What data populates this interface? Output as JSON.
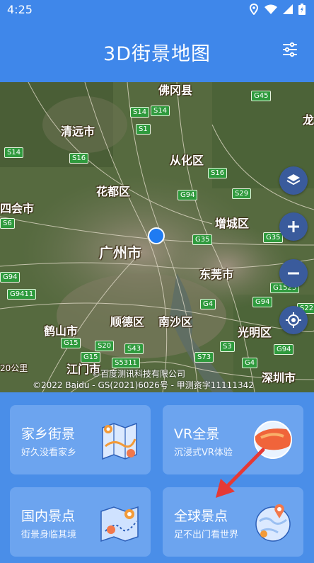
{
  "status_bar": {
    "time": "4:25"
  },
  "app_bar": {
    "title": "3D街景地图"
  },
  "map": {
    "places": {
      "foshan_north": "佛冈县",
      "qingyuan": "清远市",
      "conghua": "从化区",
      "huadu": "花都区",
      "sihui": "四会市",
      "zengcheng": "增城区",
      "guangzhou": "广州市",
      "dongguan": "东莞市",
      "heshan": "鹤山市",
      "shunde": "顺德区",
      "nansha": "南沙区",
      "guangming": "光明区",
      "jiangmen": "江门市",
      "shenzhen": "深圳市",
      "dragon": "龙"
    },
    "roads": [
      "G45",
      "S14",
      "S14",
      "S1",
      "S14",
      "S16",
      "S16",
      "G94",
      "S29",
      "G35",
      "G35",
      "G94",
      "G9411",
      "G4",
      "G94",
      "G15",
      "S20",
      "G15",
      "S43",
      "S5311",
      "S73",
      "S3",
      "G94",
      "G4",
      "S22",
      "G1523",
      "S6"
    ],
    "copyright_line1": "©百度测讯科技有限公司",
    "copyright_line2": "©2022 Baidu - GS(2021)6026号 - 甲测资字11111342",
    "scale_label": "20公里"
  },
  "cards": [
    {
      "title": "家乡街景",
      "subtitle": "好久没看家乡"
    },
    {
      "title": "VR全景",
      "subtitle": "沉浸式VR体验"
    },
    {
      "title": "国内景点",
      "subtitle": "街景身临其境"
    },
    {
      "title": "全球景点",
      "subtitle": "足不出门看世界"
    }
  ],
  "colors": {
    "app_bar": "#3f87ea",
    "card_bg": "#6ca4ef",
    "body_bg": "#4a8ee8",
    "map_button": "#3a5b9c",
    "arrow": "#e53935"
  }
}
